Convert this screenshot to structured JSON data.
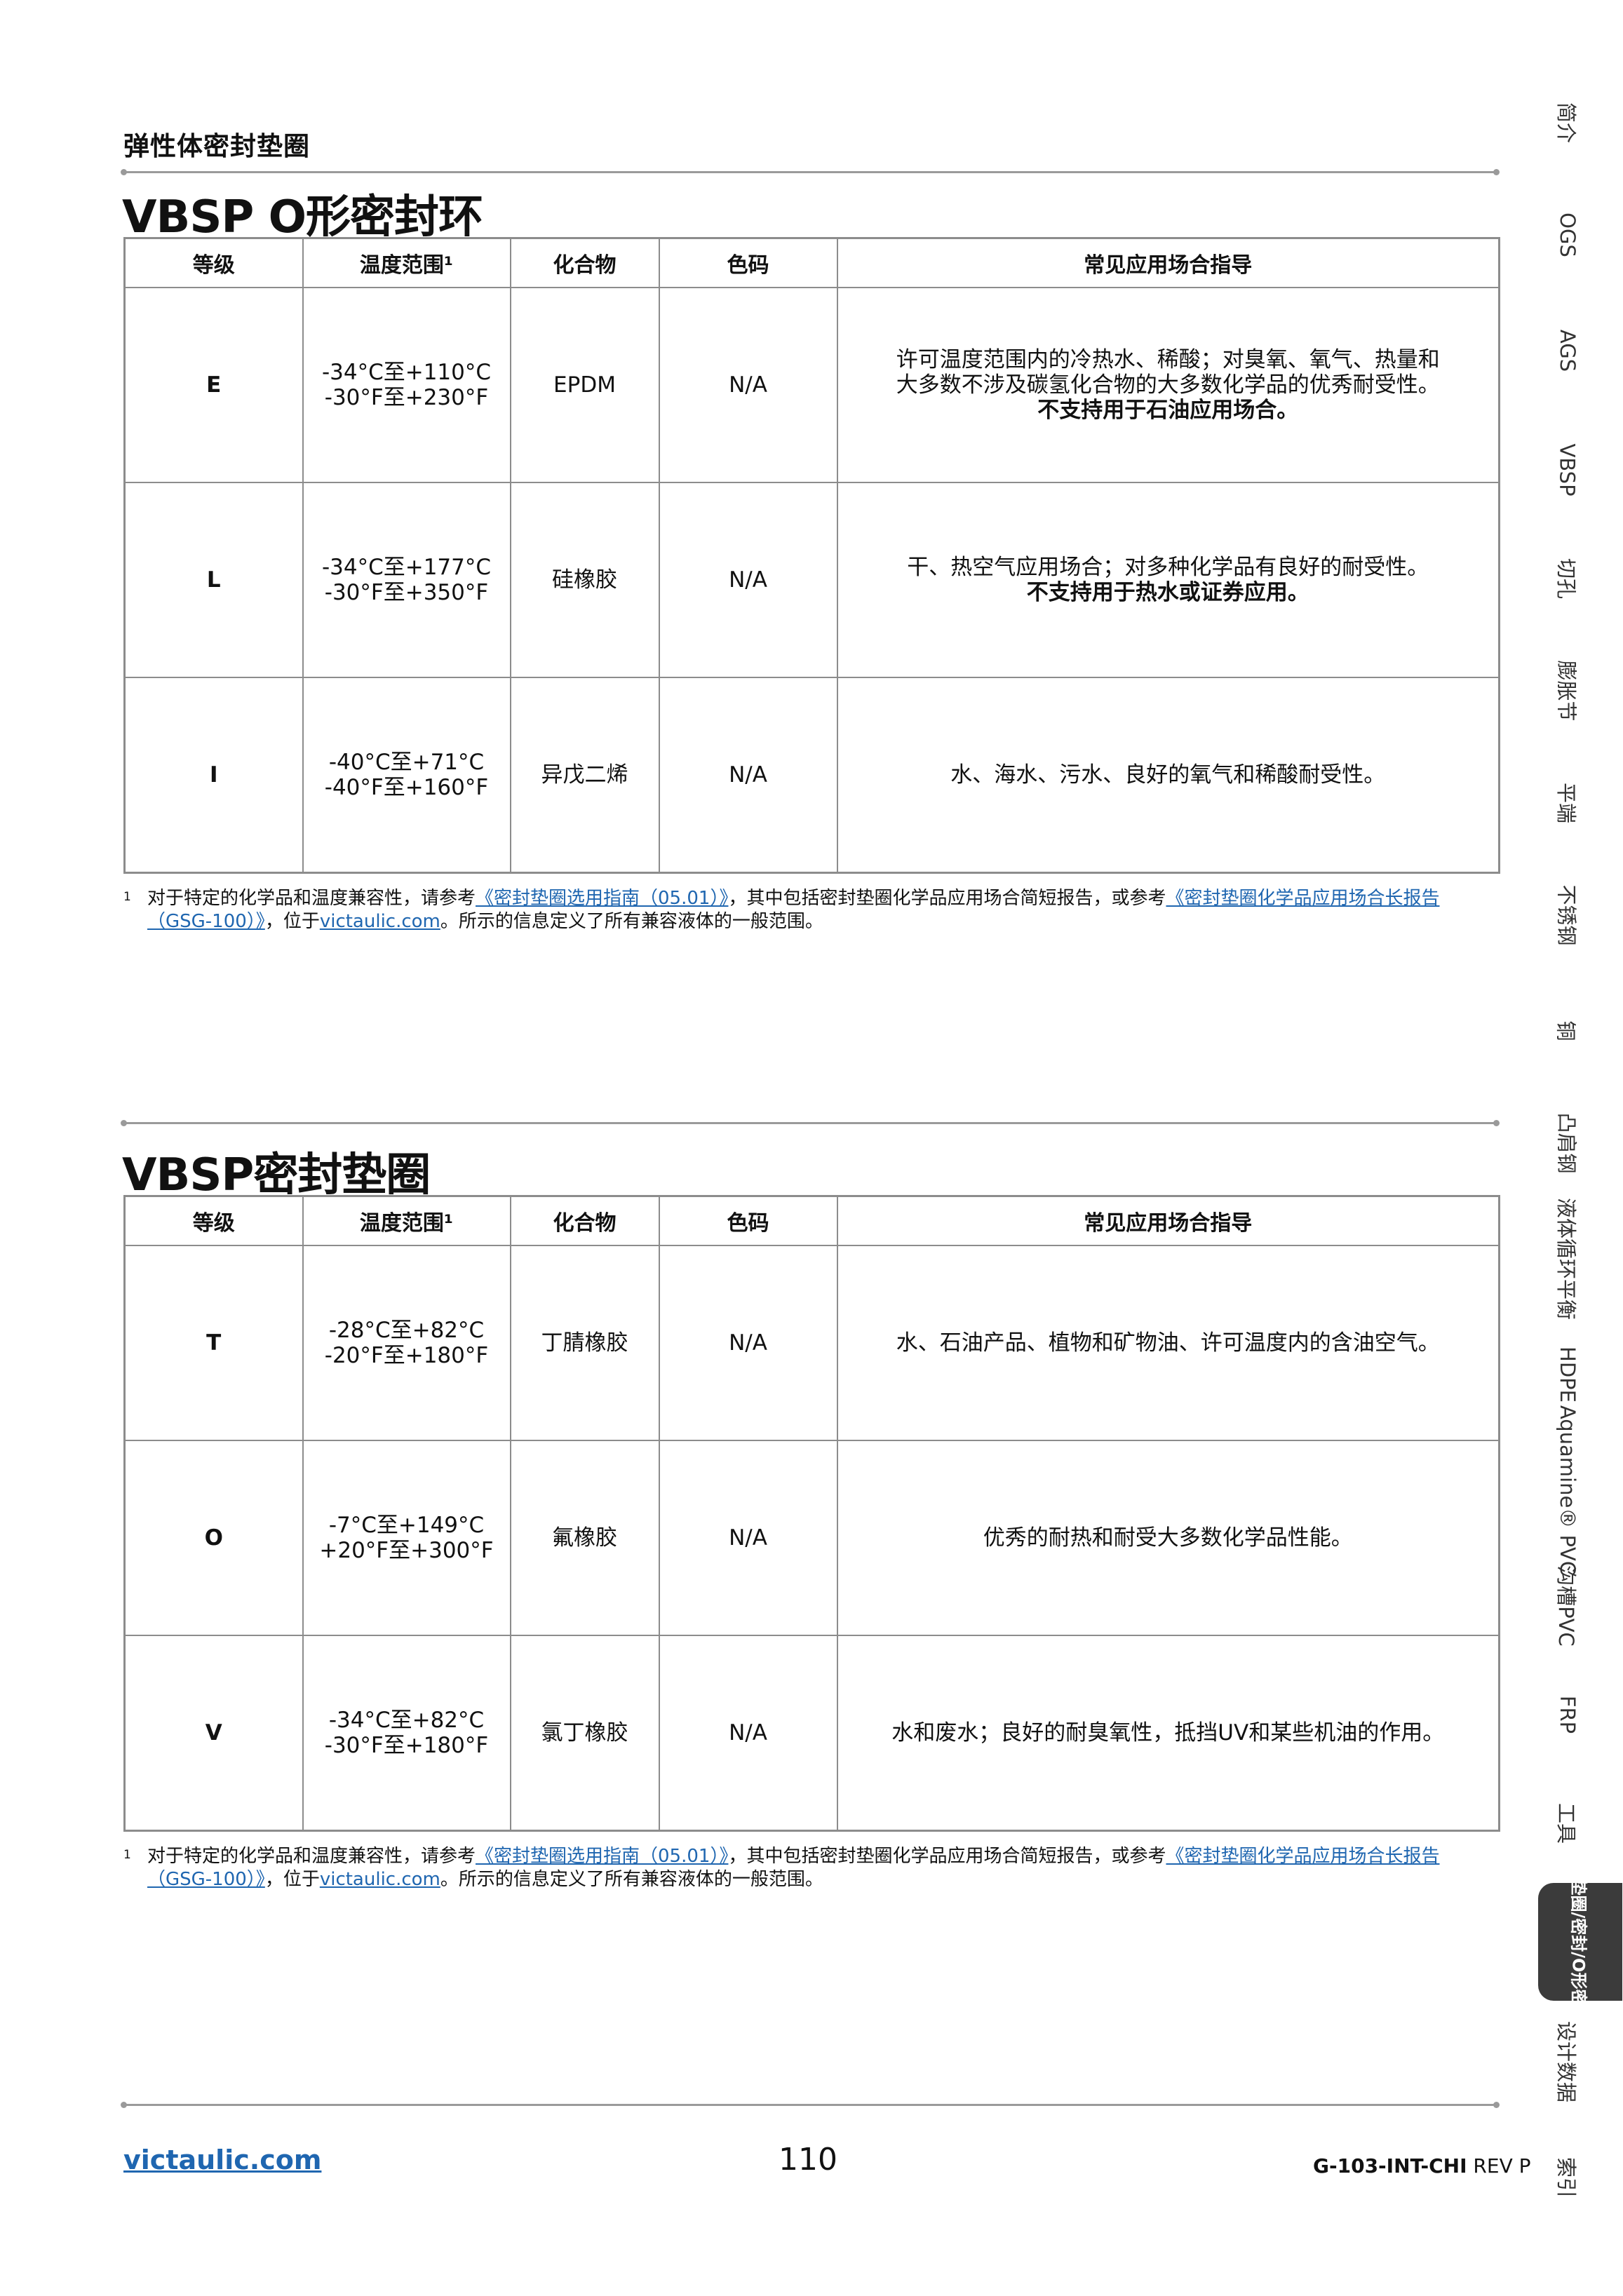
{
  "section_label": "弹性体密封垫圈",
  "table_headers": [
    "等级",
    "温度范围¹",
    "化合物",
    "色码",
    "常见应用场合指导"
  ],
  "oring": {
    "title": "VBSP O形密封环",
    "rows": [
      {
        "grade": "E",
        "temp_c": "-34°C至+110°C",
        "temp_f": "-30°F至+230°F",
        "compound": "EPDM",
        "color_code": "N/A",
        "desc_lines": [
          "许可温度范围内的冷热水、稀酸；对臭氧、氧气、热量和",
          "大多数不涉及碳氢化合物的大多数化学品的优秀耐受性。"
        ],
        "desc_bold": "不支持用于石油应用场合。"
      },
      {
        "grade": "L",
        "temp_c": "-34°C至+177°C",
        "temp_f": "-30°F至+350°F",
        "compound": "硅橡胶",
        "color_code": "N/A",
        "desc_lines": [
          "干、热空气应用场合；对多种化学品有良好的耐受性。"
        ],
        "desc_bold": "不支持用于热水或证券应用。"
      },
      {
        "grade": "I",
        "temp_c": "-40°C至+71°C",
        "temp_f": "-40°F至+160°F",
        "compound": "异戊二烯",
        "color_code": "N/A",
        "desc_lines": [
          "水、海水、污水、良好的氧气和稀酸耐受性。"
        ],
        "desc_bold": ""
      }
    ]
  },
  "gasket": {
    "title": "VBSP密封垫圈",
    "rows": [
      {
        "grade": "T",
        "temp_c": "-28°C至+82°C",
        "temp_f": "-20°F至+180°F",
        "compound": "丁腈橡胶",
        "color_code": "N/A",
        "desc_lines": [
          "水、石油产品、植物和矿物油、许可温度内的含油空气。"
        ],
        "desc_bold": ""
      },
      {
        "grade": "O",
        "temp_c": "-7°C至+149°C",
        "temp_f": "+20°F至+300°F",
        "compound": "氟橡胶",
        "color_code": "N/A",
        "desc_lines": [
          "优秀的耐热和耐受大多数化学品性能。"
        ],
        "desc_bold": ""
      },
      {
        "grade": "V",
        "temp_c": "-34°C至+82°C",
        "temp_f": "-30°F至+180°F",
        "compound": "氯丁橡胶",
        "color_code": "N/A",
        "desc_lines": [
          "水和废水；良好的耐臭氧性，抵挡UV和某些机油的作用。"
        ],
        "desc_bold": ""
      }
    ]
  },
  "footnote": {
    "marker": "1",
    "part1": "对于特定的化学品和温度兼容性，请参考",
    "link1": "《密封垫圈选用指南（05.01）》",
    "part2": "，其中包括密封垫圈化学品应用场合简短报告，或参考",
    "link2": "《密封垫圈化学品应用场合长报告（GSG-100）》",
    "part3": "，位于",
    "link3": "victaulic.com",
    "part4": "。所示的信息定义了所有兼容液体的一般范围。"
  },
  "footer": {
    "url": "victaulic.com",
    "page_number": "110",
    "doc_id_bold": "G-103-INT-CHI",
    "doc_id_rev": " REV P"
  },
  "side_tabs": [
    "简介",
    "OGS",
    "AGS",
    "VBSP",
    "切孔",
    "膨胀节",
    "平端",
    "不锈钢",
    "铜",
    "凸肩钢",
    "液体循环平衡",
    "HDPE",
    "Aquamine® PVC",
    "沟槽PVC",
    "FRP",
    "工具",
    "密封垫圈/密封/O形密封环",
    "设计数据",
    "索引"
  ],
  "active_tab": "密封垫圈/密封/O形密封环"
}
